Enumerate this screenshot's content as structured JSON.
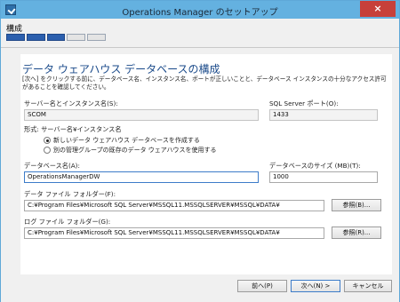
{
  "window": {
    "title": "Operations Manager のセットアップ",
    "close_label": "×"
  },
  "header": {
    "step_title": "構成",
    "progress": {
      "total_steps": 5,
      "completed_steps": 3
    }
  },
  "page": {
    "title": "データ ウェアハウス データベースの構成",
    "description": "[次へ] をクリックする前に、データベース名、インスタンス名、ポートが正しいことと、データベース インスタンスの十分なアクセス許可があることを確認してください。"
  },
  "form": {
    "server_label": "サーバー名とインスタンス名(S):",
    "server_value": "SCOM",
    "port_label": "SQL Server ポート(O):",
    "port_value": "1433",
    "format_hint": "形式: サーバー名¥インスタンス名",
    "radio_new_label": "新しいデータ ウェアハウス データベースを作成する",
    "radio_existing_label": "別の管理グループの既存のデータ ウェアハウスを使用する",
    "db_name_label": "データベース名(A):",
    "db_name_value": "OperationsManagerDW",
    "db_size_label": "データベースのサイズ (MB)(T):",
    "db_size_value": "1000",
    "data_folder_label": "データ ファイル フォルダー(F):",
    "data_folder_value": "C:¥Program Files¥Microsoft SQL Server¥MSSQL11.MSSQLSERVER¥MSSQL¥DATA¥",
    "data_browse_label": "参照(B)...",
    "log_folder_label": "ログ ファイル フォルダー(G):",
    "log_folder_value": "C:¥Program Files¥Microsoft SQL Server¥MSSQL11.MSSQLSERVER¥MSSQL¥DATA¥",
    "log_browse_label": "参照(R)..."
  },
  "footer": {
    "back_label": "前へ(P)",
    "next_label": "次へ(N) >",
    "cancel_label": "キャンセル"
  }
}
